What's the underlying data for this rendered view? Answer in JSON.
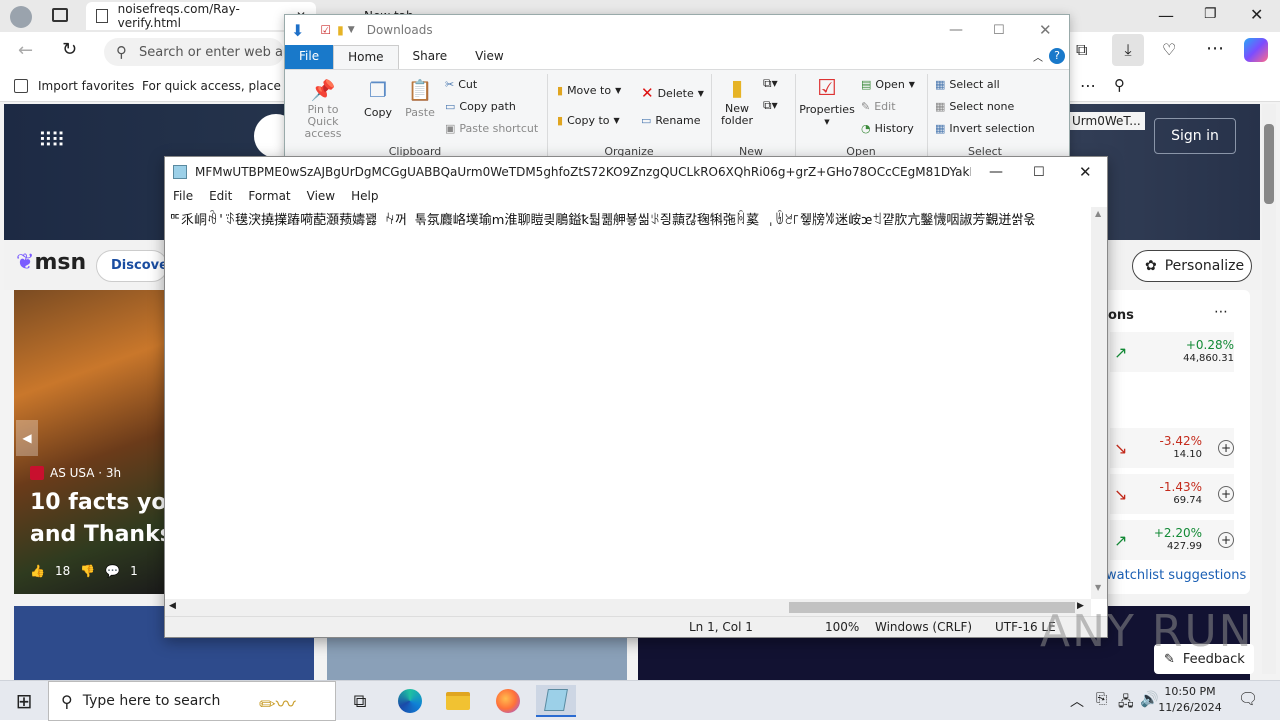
{
  "browser": {
    "tab_active": "noisefreqs.com/Ray-verify.html",
    "tab_next": "New tab",
    "address_placeholder": "Search or enter web a",
    "favbar": {
      "import": "Import favorites",
      "hint": "For quick access, place you"
    },
    "msn": {
      "discover": "Discover",
      "sign_in": "Sign in",
      "personalize": "Personalize",
      "hero_partial": "Urm0WeT...",
      "card_source": "AS USA · 3h",
      "card_title_line1": "10 facts you",
      "card_title_line2": "and Thanksg",
      "likes": "18",
      "comments": "1",
      "side_header": "ons",
      "watchlist": "watchlist suggestions",
      "feedback": "Feedback",
      "stocks": [
        {
          "change": "+0.28%",
          "price": "44,860.31",
          "color": "#138a36"
        },
        {
          "change": "-3.42%",
          "price": "14.10",
          "color": "#c42b1c"
        },
        {
          "change": "-1.43%",
          "price": "69.74",
          "color": "#c42b1c"
        },
        {
          "change": "+2.20%",
          "price": "427.99",
          "color": "#138a36"
        }
      ]
    }
  },
  "explorer": {
    "title": "Downloads",
    "tabs": [
      "File",
      "Home",
      "Share",
      "View"
    ],
    "clipboard": {
      "pin": "Pin to Quick access",
      "copy": "Copy",
      "paste": "Paste",
      "cut": "Cut",
      "copy_path": "Copy path",
      "paste_shortcut": "Paste shortcut",
      "label": "Clipboard"
    },
    "organize": {
      "move_to": "Move to",
      "copy_to": "Copy to",
      "delete": "Delete",
      "rename": "Rename",
      "label": "Organize"
    },
    "new": {
      "new_folder": "New folder",
      "label": "New"
    },
    "open": {
      "properties": "Properties",
      "open": "Open",
      "edit": "Edit",
      "history": "History",
      "label": "Open"
    },
    "select": {
      "select_all": "Select all",
      "select_none": "Select none",
      "invert": "Invert selection",
      "label": "Select"
    }
  },
  "notepad": {
    "title": "MFMwUTBPME0wSzAJBgUrDgMCGgUABBQaUrm0WeTDM5ghfoZtS72KO9ZnzgQUCLkRO6XQhRi06g+grZ+GHo78OCcCEgM81DYakMxEG0IQ2RN...",
    "menu": [
      "File",
      "Edit",
      "Format",
      "View",
      "Help"
    ],
    "content": "ꥰ乑峒ꆁ'ꈄ氁涋撓擈蹖嗬蓜㶊蓣嬦꽳 ꈙ꺼 톢氛麚峈墣瑜ⅿ淮聊䁗킞鵰鎰ꝁ퉓퀢舺뵿씲ꂪ즹蘏칺毱犐㢮ꏊ蒵 ˌꉄ꧲꜒쥏牓ꊧ迷峖ꭢꉬ꺝肷亢鑿懱咽諔芳覲迸쌁욳",
    "status": {
      "position": "Ln 1, Col 1",
      "zoom": "100%",
      "eol": "Windows (CRLF)",
      "encoding": "UTF-16 LE"
    }
  },
  "taskbar": {
    "search": "Type here to search",
    "time": "10:50 PM",
    "date": "11/26/2024"
  },
  "watermark": "ANY RUN"
}
